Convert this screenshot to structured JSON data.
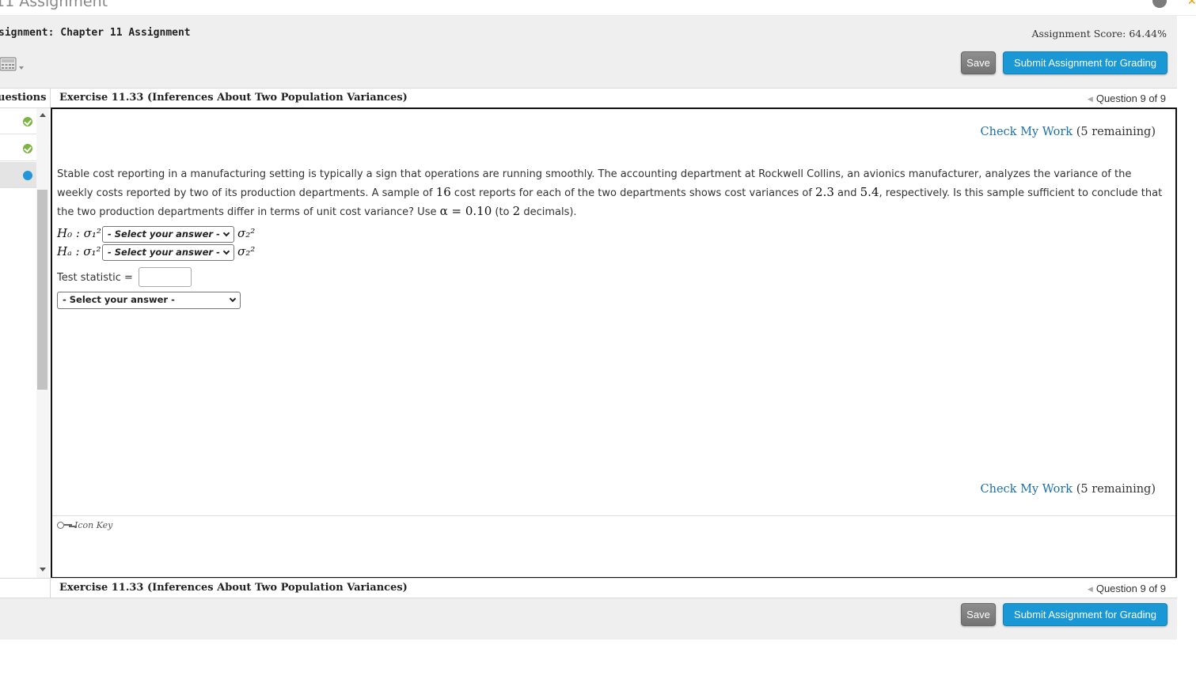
{
  "window": {
    "title": "11 Assignment"
  },
  "header": {
    "assignment_title": "signment: Chapter 11 Assignment",
    "score": "Assignment Score: 64.44%",
    "save_label": "Save",
    "submit_label": "Submit Assignment for Grading"
  },
  "question_strip": {
    "questions_label": "uestions",
    "exercise_title": "Exercise 11.33 (Inferences About Two Population Variances)",
    "question_nav": "Question 9 of 9"
  },
  "sidebar": {
    "items": [
      {
        "status": "completed",
        "icon": "check-circle-icon"
      },
      {
        "status": "completed",
        "icon": "check-circle-icon"
      },
      {
        "status": "current",
        "icon": "current-dot-icon"
      }
    ]
  },
  "content": {
    "check_my_work": "Check My Work",
    "remaining": "(5 remaining)",
    "problem": {
      "t1": "Stable cost reporting in a manufacturing setting is typically a sign that operations are running smoothly. The accounting department at Rockwell Collins, an avionics manufacturer, analyzes the variance of the weekly costs reported by two of its production departments. A sample of ",
      "n": "16",
      "t2": " cost reports for each of the two departments shows cost variances of ",
      "v1": "2.3",
      "t3": " and ",
      "v2": "5.4",
      "t4": ", respectively. Is this sample sufficient to conclude that the two production departments differ in terms of unit cost variance? Use ",
      "alpha": "α = 0.10",
      "t5": " (to ",
      "decimals": "2",
      "t6": " decimals)."
    },
    "h0_label": "H₀ : σ₁²",
    "ha_label": "Hₐ : σ₁²",
    "rhs_label": "σ₂²",
    "h0_select": "- Select your answer -",
    "ha_select": "- Select your answer -",
    "test_statistic_label": "Test statistic =",
    "test_statistic_value": "",
    "conclusion_select": "- Select your answer -",
    "icon_key": "Icon Key"
  },
  "footer": {
    "save_label": "Save",
    "submit_label": "Submit Assignment for Grading"
  },
  "colors": {
    "submit_blue": "#1998d5",
    "link_blue": "#1a6fb0",
    "completed_green": "#7cb342",
    "current_blue": "#2196d9"
  }
}
